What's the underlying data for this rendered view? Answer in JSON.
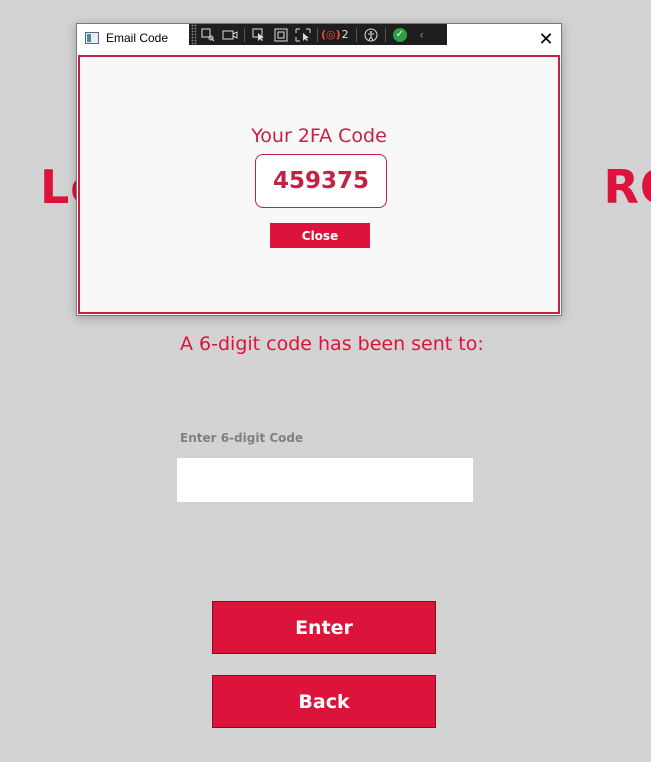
{
  "background": {
    "title_partial": "Lo",
    "title_partial_end": "RO",
    "sent_text": "A 6-digit code has been sent to:",
    "code_label": "Enter 6-digit Code",
    "code_value": "",
    "enter_button": "Enter",
    "back_button": "Back"
  },
  "dialog": {
    "window_title": "Email Code",
    "heading": "Your 2FA Code",
    "code": "459375",
    "close_button": "Close",
    "close_glyph": "✕"
  },
  "devtools": {
    "error_count": "2"
  },
  "colors": {
    "accent": "#dc143c",
    "background": "#d3d3d3"
  }
}
